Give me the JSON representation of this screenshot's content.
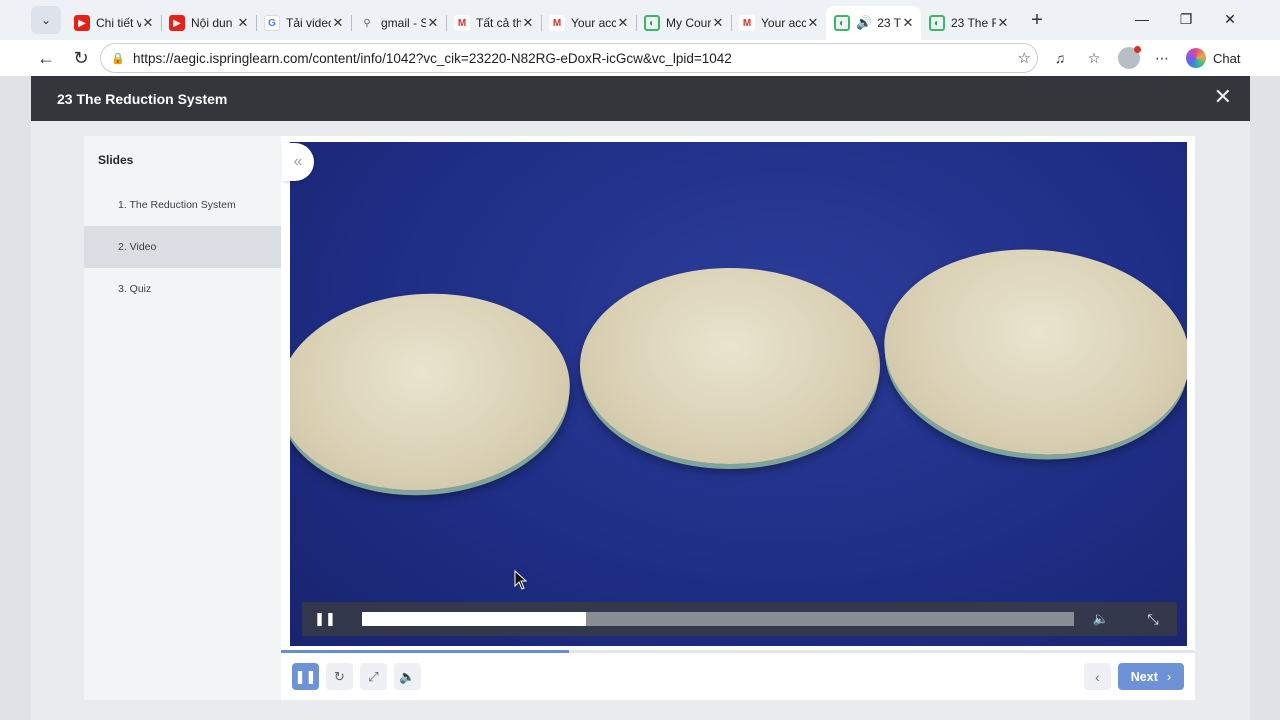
{
  "browser": {
    "tabs": [
      {
        "title": "Chi tiết v",
        "icon": "youtube-icon",
        "favicon": "▶"
      },
      {
        "title": "Nội dun",
        "icon": "youtube-icon",
        "favicon": "▶"
      },
      {
        "title": "Tải video",
        "icon": "google-icon",
        "favicon": "G"
      },
      {
        "title": "gmail - S",
        "icon": "search-icon",
        "favicon": "⚲"
      },
      {
        "title": "Tất cả th",
        "icon": "gmail-icon",
        "favicon": "M"
      },
      {
        "title": "Your acc",
        "icon": "gmail-icon",
        "favicon": "M"
      },
      {
        "title": "My Cour",
        "icon": "ispring-icon",
        "favicon": "◐"
      },
      {
        "title": "Your acc",
        "icon": "gmail-icon",
        "favicon": "M"
      },
      {
        "title": "23 T",
        "icon": "ispring-icon",
        "favicon": "◐",
        "active": true,
        "audio": "🔊"
      },
      {
        "title": "23 The R",
        "icon": "ispring-icon",
        "favicon": "◐"
      }
    ],
    "url": "https://aegic.ispringlearn.com/content/info/1042?vc_cik=23220-N82RG-eDoxR-icGcw&vc_lpid=1042",
    "chat_label": "Chat"
  },
  "course": {
    "title": "23 The Reduction System",
    "sidebar_heading": "Slides",
    "slides": [
      {
        "label": "1. The Reduction System"
      },
      {
        "label": "2. Video",
        "selected": true
      },
      {
        "label": "3. Quiz"
      }
    ],
    "next_label": "Next"
  },
  "video": {
    "progress": 0.314,
    "slide_progress": 0.315
  }
}
